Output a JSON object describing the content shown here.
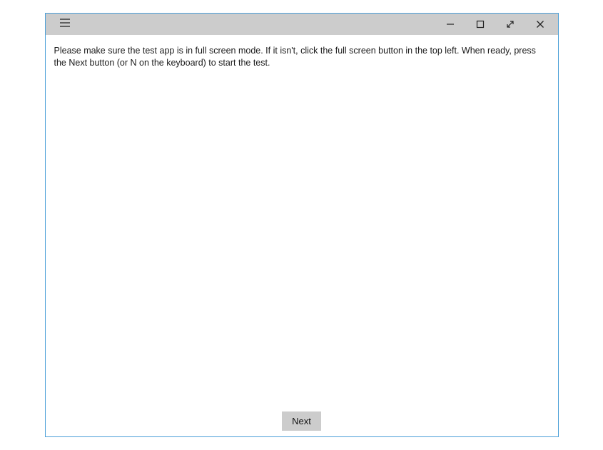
{
  "titlebar": {
    "menu_icon": "hamburger-icon",
    "controls": {
      "minimize": "minimize-icon",
      "maximize": "maximize-icon",
      "fullscreen": "fullscreen-icon",
      "close": "close-icon"
    }
  },
  "content": {
    "instructions": "Please make sure the test app is in full screen mode. If it isn't, click the full screen button in the top left. When ready, press the Next button (or N on the keyboard) to start the test."
  },
  "footer": {
    "next_label": "Next"
  }
}
